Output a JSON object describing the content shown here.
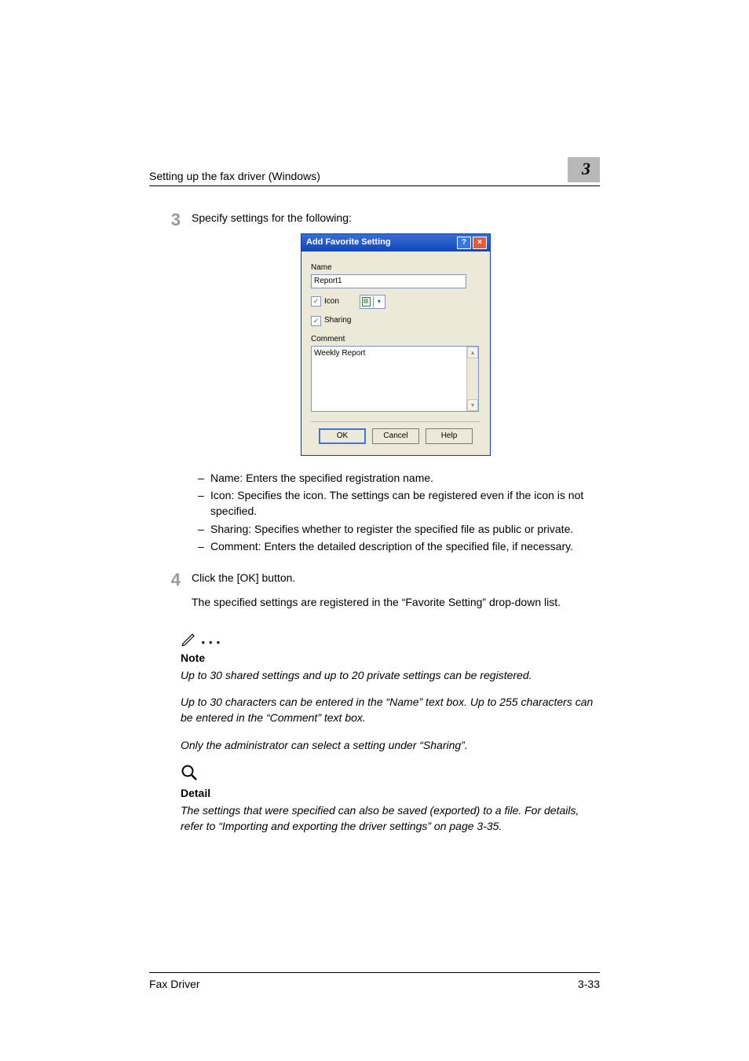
{
  "header": {
    "title": "Setting up the fax driver (Windows)",
    "chapter_badge": "3"
  },
  "steps": {
    "s3": {
      "num": "3",
      "text": "Specify settings for the following:",
      "bullets": [
        "Name: Enters the specified registration name.",
        "Icon: Specifies the icon. The settings can be registered even if the icon is not specified.",
        "Sharing: Specifies whether to register the specified file as public or private.",
        "Comment: Enters the detailed description of the specified file, if necessary."
      ]
    },
    "s4": {
      "num": "4",
      "text": "Click the [OK] button.",
      "para": "The specified settings are registered in the “Favorite Setting” drop-down list."
    }
  },
  "dialog": {
    "title": "Add Favorite Setting",
    "name_label": "Name",
    "name_value": "Report1",
    "icon_label": "Icon",
    "icon_checked": true,
    "sharing_label": "Sharing",
    "sharing_checked": true,
    "comment_label": "Comment",
    "comment_value": "Weekly Report",
    "ok": "OK",
    "cancel": "Cancel",
    "help": "Help"
  },
  "note": {
    "label": "Note",
    "p1": "Up to 30 shared settings and up to 20 private settings can be registered.",
    "p2": "Up to 30 characters can be entered in the “Name” text box. Up to 255 characters can be entered in the “Comment” text box.",
    "p3": "Only the administrator can select a setting under “Sharing”."
  },
  "detail": {
    "label": "Detail",
    "text": "The settings that were specified can also be saved (exported) to a file. For details, refer to “Importing and exporting the driver settings” on page 3-35."
  },
  "footer": {
    "left": "Fax Driver",
    "right": "3-33"
  }
}
